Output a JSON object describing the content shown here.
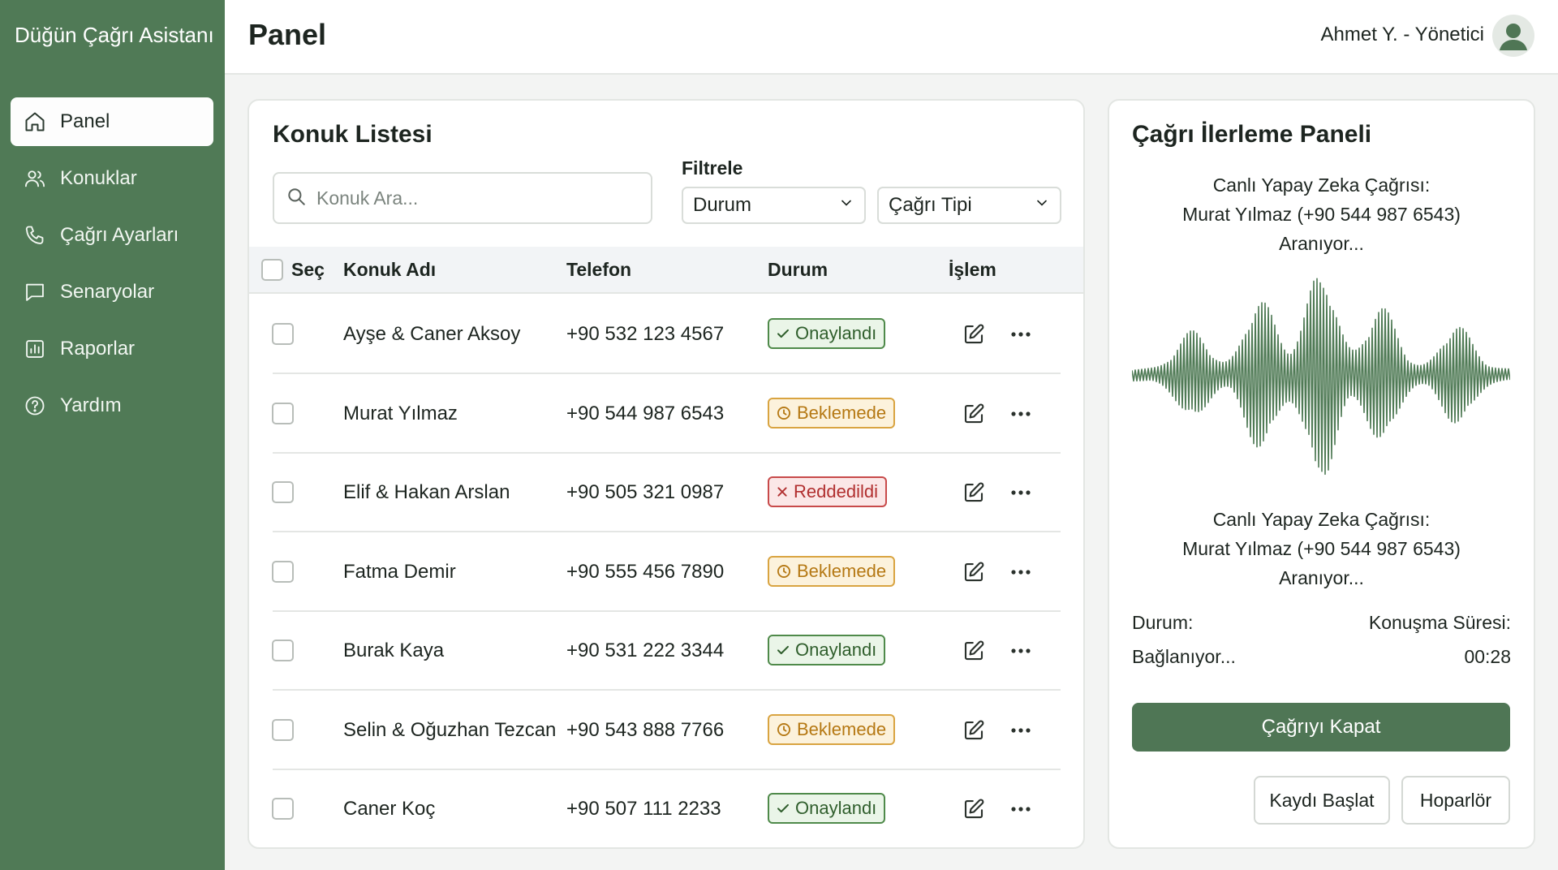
{
  "app": {
    "title": "Düğün Çağrı Asistanı"
  },
  "sidebar": {
    "items": [
      {
        "label": "Panel",
        "icon": "home-icon",
        "active": true
      },
      {
        "label": "Konuklar",
        "icon": "users-icon"
      },
      {
        "label": "Çağrı Ayarları",
        "icon": "phone-icon"
      },
      {
        "label": "Senaryolar",
        "icon": "message-icon"
      },
      {
        "label": "Raporlar",
        "icon": "chart-icon"
      },
      {
        "label": "Yardım",
        "icon": "help-icon"
      }
    ]
  },
  "header": {
    "title": "Panel",
    "user": "Ahmet Y. - Yönetici",
    "avatar_icon": "user-avatar-icon"
  },
  "guests": {
    "title": "Konuk Listesi",
    "search_placeholder": "Konuk Ara...",
    "filter_label": "Filtrele",
    "filter_status": "Durum",
    "filter_type": "Çağrı Tipi",
    "columns": {
      "select": "Seç",
      "name": "Konuk Adı",
      "phone": "Telefon",
      "status": "Durum",
      "action": "İşlem"
    },
    "rows": [
      {
        "name": "Ayşe & Caner Aksoy",
        "phone": "+90 532 123 4567",
        "status": "Onaylandı",
        "type": "ok"
      },
      {
        "name": "Murat Yılmaz",
        "phone": "+90 544 987 6543",
        "status": "Beklemede",
        "type": "wait"
      },
      {
        "name": "Elif & Hakan Arslan",
        "phone": "+90 505 321 0987",
        "status": "Reddedildi",
        "type": "no"
      },
      {
        "name": "Fatma Demir",
        "phone": "+90 555 456 7890",
        "status": "Beklemede",
        "type": "wait"
      },
      {
        "name": "Burak Kaya",
        "phone": "+90 531 222 3344",
        "status": "Onaylandı",
        "type": "ok"
      },
      {
        "name": "Selin & Oğuzhan Tezcan",
        "phone": "+90 543 888 7766",
        "status": "Beklemede",
        "type": "wait"
      },
      {
        "name": "Caner Koç",
        "phone": "+90 507 111 2233",
        "status": "Onaylandı",
        "type": "ok"
      }
    ]
  },
  "call": {
    "title": "Çağrı İlerleme Paneli",
    "line1": "Canlı Yapay Zeka Çağrısı:",
    "line2": "Murat Yılmaz (+90 544 987 6543)",
    "line3": "Aranıyor...",
    "status_label": "Durum:",
    "status_value": "Bağlanıyor...",
    "duration_label": "Konuşma Süresi:",
    "duration_value": "00:28",
    "end_button": "Çağrıyı Kapat",
    "record_button": "Kaydı Başlat",
    "speaker_button": "Hoparlör",
    "wave_color": "#4f7a55"
  }
}
